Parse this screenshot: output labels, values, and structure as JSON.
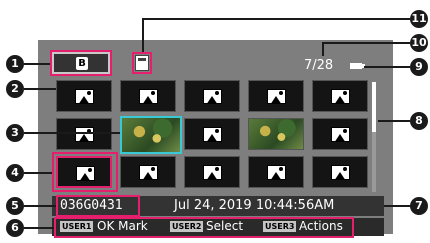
{
  "header": {
    "slot_letter": "B",
    "counter": "7/28"
  },
  "ok_mark": "OK",
  "info": {
    "clip_name": "036G0431",
    "datetime": "Jul 24, 2019  10:44:56AM"
  },
  "guide": [
    {
      "button": "USER1",
      "label": "OK Mark"
    },
    {
      "button": "USER2",
      "label": "Select"
    },
    {
      "button": "USER3",
      "label": "Actions"
    }
  ],
  "callouts": [
    "1",
    "2",
    "3",
    "4",
    "5",
    "6",
    "7",
    "8",
    "9",
    "10",
    "11"
  ],
  "colors": {
    "cursor": "#38c9d5",
    "marked": "#e61e6e",
    "screen_bg": "#7e7e7e"
  }
}
